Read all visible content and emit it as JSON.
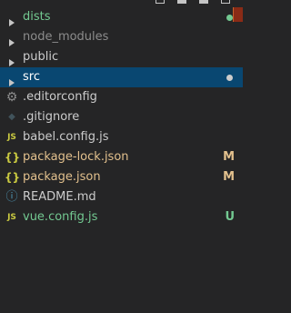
{
  "colors": {
    "background": "#252526",
    "selected_row": "#094771",
    "default_text": "#cccccc",
    "ignored_text": "#8c8c8c",
    "untracked_green": "#73c991",
    "modified_yellow": "#e2c08d",
    "js_yellow": "#cbcb41",
    "json_yellow": "#cbcb41",
    "info_blue": "#519aba",
    "vue_green": "#8dc149",
    "settings_gray": "#8c8c8c"
  },
  "explorer": {
    "items": [
      {
        "label": "dists",
        "icon": "chevron-right-icon",
        "icon_glyph": "",
        "text_color": "#73c991",
        "dot_color": "#73c991",
        "badge": ""
      },
      {
        "label": "node_modules",
        "icon": "chevron-right-icon",
        "icon_glyph": "",
        "text_color": "#8c8c8c",
        "dot_color": "",
        "badge": ""
      },
      {
        "label": "public",
        "icon": "chevron-right-icon",
        "icon_glyph": "",
        "text_color": "#cccccc",
        "dot_color": "",
        "badge": ""
      },
      {
        "label": "src",
        "icon": "chevron-right-icon",
        "icon_glyph": "",
        "text_color": "#ffffff",
        "dot_color": "#cccccc",
        "badge": "",
        "selected": true
      },
      {
        "label": ".editorconfig",
        "icon": "gear-icon",
        "icon_glyph": "⚙",
        "text_color": "#cccccc",
        "dot_color": "",
        "badge": ""
      },
      {
        "label": ".gitignore",
        "icon": "git-icon",
        "icon_glyph": "◆",
        "text_color": "#cccccc",
        "dot_color": "",
        "badge": ""
      },
      {
        "label": "babel.config.js",
        "icon": "javascript-file-icon",
        "icon_glyph": "JS",
        "text_color": "#cccccc",
        "dot_color": "",
        "badge": ""
      },
      {
        "label": "package-lock.json",
        "icon": "json-file-icon",
        "icon_glyph": "{}",
        "text_color": "#e2c08d",
        "dot_color": "",
        "badge": "M"
      },
      {
        "label": "package.json",
        "icon": "json-file-icon",
        "icon_glyph": "{}",
        "text_color": "#e2c08d",
        "dot_color": "",
        "badge": "M"
      },
      {
        "label": "README.md",
        "icon": "info-icon",
        "icon_glyph": "ⓘ",
        "text_color": "#cccccc",
        "dot_color": "",
        "badge": ""
      },
      {
        "label": "vue.config.js",
        "icon": "javascript-file-icon",
        "icon_glyph": "JS",
        "text_color": "#73c991",
        "dot_color": "",
        "badge": "U"
      }
    ]
  }
}
